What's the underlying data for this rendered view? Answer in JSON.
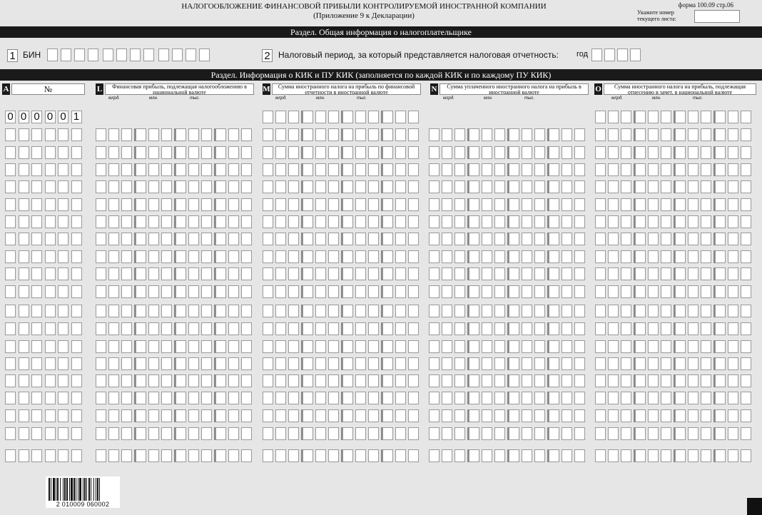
{
  "header": {
    "title_line1": "НАЛОГООБЛОЖЕНИЕ ФИНАНСОВОЙ ПРИБЫЛИ КОНТРОЛИРУЕМОЙ ИНОСТРАННОЙ КОМПАНИИ",
    "title_line2": "(Приложение 9 к Декларации)",
    "form_id": "форма 100.09  стр.06",
    "sheet_label_1": "Укажите номер",
    "sheet_label_2": "текущего листа:"
  },
  "section1": {
    "title": "Раздел. Общая информация о налогоплательщике",
    "field1_num": "1",
    "field1_label": "БИН",
    "field2_num": "2",
    "field2_label": "Налоговый период, за который представляется налоговая отчетность:",
    "year_label": "год"
  },
  "section2": {
    "title": "Раздел. Информация о КИК и ПУ КИК (заполняется по каждой КИК и по каждому ПУ КИК)",
    "columns": [
      {
        "letter": "A",
        "title": "№"
      },
      {
        "letter": "L",
        "title": "Финансовая прибыль, подлежащая налогообложению в национальной  валюте"
      },
      {
        "letter": "M",
        "title": "Сумма иностранного налога на прибыль по финансовой отчетности в иностранной валюте"
      },
      {
        "letter": "N",
        "title": "Сумма уплаченного иностранного налога на прибыль в иностранной валюте"
      },
      {
        "letter": "O",
        "title": "Сумма иностранного налога на прибыль, подлежащая отнесению в зачет, в национальной валюте"
      }
    ],
    "scale_labels": [
      "млрд.",
      "млн.",
      "тыс."
    ],
    "first_row_number": [
      "0",
      "0",
      "0",
      "0",
      "0",
      "1"
    ],
    "row_count": 19
  },
  "barcode": {
    "digits": "2 010009 060002"
  }
}
